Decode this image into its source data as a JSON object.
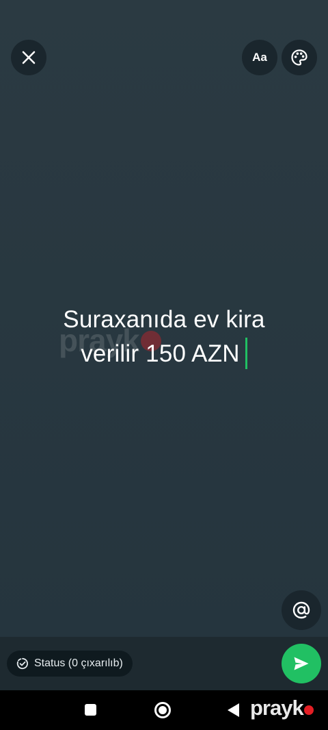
{
  "toolbar": {
    "font_label": "Aa"
  },
  "status": {
    "text_line1": "Suraxanıda ev kira",
    "text_line2": "verilir 150 AZN"
  },
  "watermark": {
    "text": "prayk"
  },
  "bottom": {
    "audience_label": "Status (0 çıxarılıb)"
  },
  "colors": {
    "background": "#26353d",
    "accent": "#21c063",
    "chip": "#0f1a1f"
  },
  "icons": {
    "close": "close-icon",
    "palette": "palette-icon",
    "mention": "at-sign-icon",
    "send": "send-icon",
    "status": "status-ring-icon"
  }
}
